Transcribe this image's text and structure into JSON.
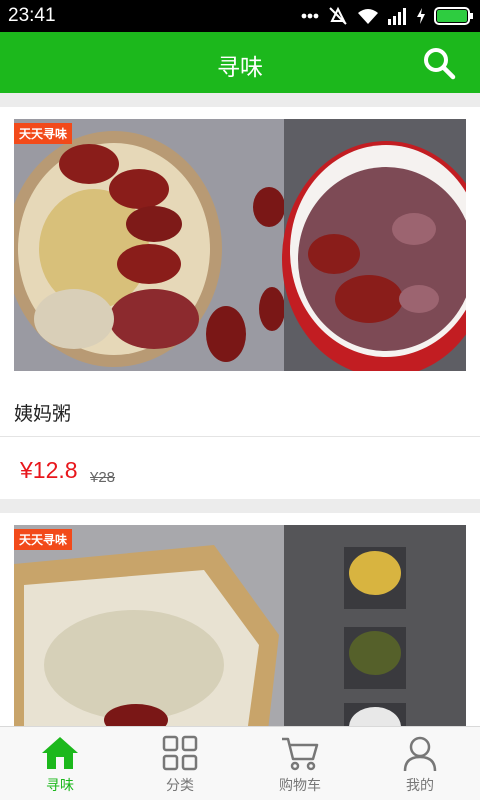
{
  "status_bar": {
    "time": "23:41"
  },
  "header": {
    "title": "寻味",
    "search_icon": "search-icon"
  },
  "products": [
    {
      "tag": "天天寻味",
      "name": "姨妈粥",
      "price": "¥12.8",
      "original_price": "¥28"
    },
    {
      "tag": "天天寻味"
    }
  ],
  "tabs": [
    {
      "label": "寻味",
      "icon": "home-icon",
      "active": true
    },
    {
      "label": "分类",
      "icon": "grid-icon",
      "active": false
    },
    {
      "label": "购物车",
      "icon": "cart-icon",
      "active": false
    },
    {
      "label": "我的",
      "icon": "user-icon",
      "active": false
    }
  ],
  "colors": {
    "brand": "#1cb81c",
    "price": "#e8161b",
    "tag": "#f24a1a"
  }
}
